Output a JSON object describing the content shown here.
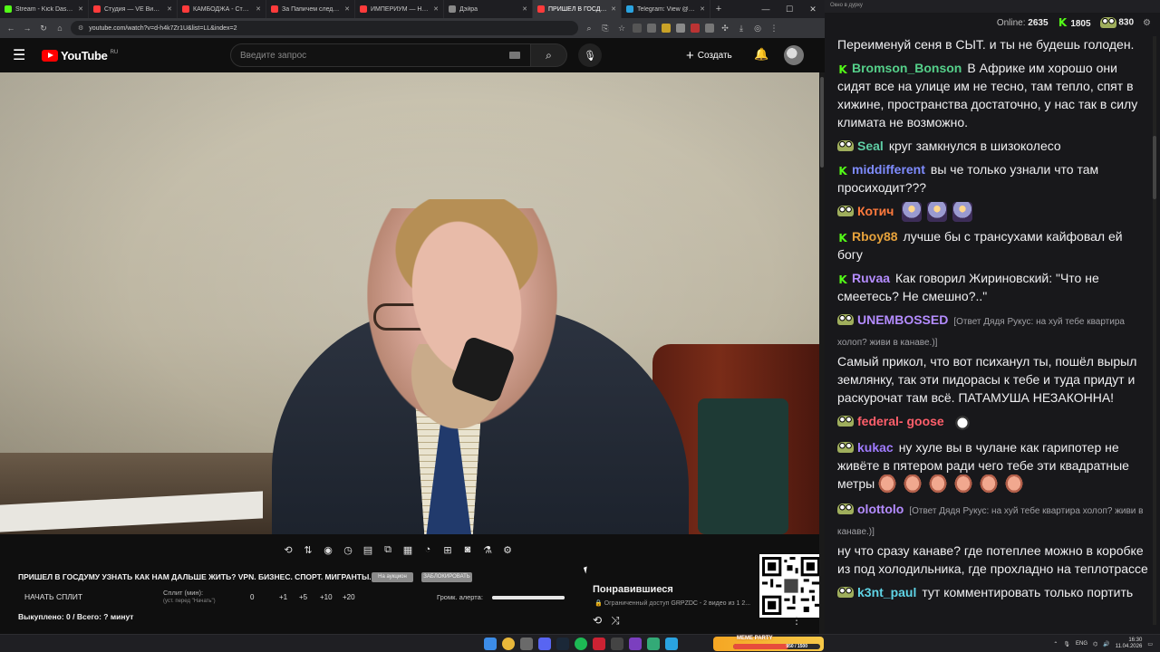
{
  "browser": {
    "tabs": [
      {
        "title": "Stream - Kick Dashboard",
        "color": "#53fc18"
      },
      {
        "title": "Студия — VE Видео Li...",
        "color": "#ff3b3b"
      },
      {
        "title": "КАМБОДЖА - Столиц...",
        "color": "#ff3b3b"
      },
      {
        "title": "За Папичем следят в ...",
        "color": "#ff3b3b"
      },
      {
        "title": "ИМПЕРИУМ — НЕ РО...",
        "color": "#ff3b3b"
      },
      {
        "title": "Дэйра",
        "color": "#888888"
      },
      {
        "title": "ПРИШЁЛ В ГОСДУМУ ...",
        "color": "#ff3b3b",
        "active": true
      },
      {
        "title": "Telegram: View @dvc...",
        "color": "#2aa3e0"
      }
    ],
    "url": "youtube.com/watch?v=d-h4k7Zr1U&list=LL&index=2"
  },
  "youtube": {
    "logo_text": "YouTube",
    "region": "RU",
    "search_placeholder": "Введите запрос",
    "create_label": "Создать"
  },
  "video_panel": {
    "title": "ПРИШЕЛ В ГОСДУМУ УЗНАТЬ КАК НАМ ДАЛЬШЕ ЖИТЬ? VPN. БИЗНЕС. СПОРТ. МИГРАНТЫ.",
    "badge1": "На аукцион",
    "badge2": "ЗАБЛОКИРОВАТЬ",
    "split_button": "НАЧАТЬ СПЛИТ",
    "split_label": "Сплит (мин):",
    "split_hint": "(уст. перед \"Начать\")",
    "split_values": [
      "0",
      "+1",
      "+5",
      "+10",
      "+20"
    ],
    "volume_label": "Громк. алерта:",
    "volume_level": 1.0,
    "bought": "Выкуплено: 0 / Всего: ? минут"
  },
  "playlist": {
    "title": "Понравившиеся",
    "restricted": "Ограниченный доступ",
    "meta": "GRPZDC - 2 видео из 1 2..."
  },
  "chat": {
    "window_title": "Окно в дурку",
    "online_label": "Online:",
    "online_count": "2635",
    "kick_count": "1805",
    "frog_count": "830",
    "messages": [
      {
        "platform": "",
        "user": "",
        "user_color": "#efeff1",
        "reply": "",
        "text": "Переименуй сеня в СЫТ. и ты не будешь голоден.",
        "emotes": []
      },
      {
        "platform": "kick",
        "user": "Bromson_Bonson",
        "user_color": "#55d08a",
        "reply": "",
        "text": "В Африке им хорошо они сидят все на улице им не тесно, там тепло, спят в хижине, пространства достаточно, у нас так в силу климата не возможно.",
        "emotes": []
      },
      {
        "platform": "frog",
        "user": "Seal",
        "user_color": "#5fcda5",
        "reply": "",
        "text": "круг замкнулся в шизоколесо",
        "emotes": []
      },
      {
        "platform": "kick",
        "user": "middifferent",
        "user_color": "#7f8cff",
        "reply": "",
        "text": "вы че только узнали что там просиходит???",
        "emotes": []
      },
      {
        "platform": "frog",
        "user": "Котич",
        "user_color": "#ff7a3d",
        "reply": "",
        "text": "",
        "emotes": [
          "rocket",
          "rocket",
          "rocket"
        ]
      },
      {
        "platform": "kick",
        "user": "Rboy88",
        "user_color": "#e6a23c",
        "reply": "",
        "text": "лучше бы с трансухами кайфовал ей богу",
        "emotes": []
      },
      {
        "platform": "kick",
        "user": "Ruvaa",
        "user_color": "#b48cff",
        "reply": "",
        "text": "Как говорил Жириновский: \"Что не смеетесь? Не смешно?..\"",
        "emotes": []
      },
      {
        "platform": "frog",
        "user": "UNEMBOSSED",
        "user_color": "#b48cff",
        "reply": "[Ответ Дядя Рукус: на хуй тебе квартира холоп? живи в канаве.)]",
        "text": "Самый прикол, что вот психанул ты, пошёл вырыл землянку, так эти пидорасы к тебе и туда придут и раскурочат там всё. ПАТАМУША НЕЗАКОННА!",
        "emotes": []
      },
      {
        "platform": "frog",
        "user": "federal- goose",
        "user_color": "#ff5f6b",
        "reply": "",
        "text": "",
        "emotes": [
          "blob"
        ]
      },
      {
        "platform": "frog",
        "user": "kukac",
        "user_color": "#a07bff",
        "reply": "",
        "text": "ну хуле вы в чулане как гарипотер не живёте в пятером ради чего тебе эти квадратные метры",
        "emotes": [
          "face",
          "face",
          "face",
          "face",
          "face",
          "face"
        ]
      },
      {
        "platform": "frog",
        "user": "olottolo",
        "user_color": "#b48cff",
        "reply": "[Ответ Дядя Рукус: на хуй тебе квартира холоп? живи в канаве.)]",
        "text": "ну что сразу канаве? где потеплее можно в коробке из под холодильника, где прохладно на теплотрассе",
        "emotes": []
      },
      {
        "platform": "frog",
        "user": "k3nt_paul",
        "user_color": "#5fd4e6",
        "reply": "",
        "text": "тут комментировать только портить",
        "emotes": []
      }
    ]
  },
  "taskbar": {
    "meme_title": "MEME PARTY",
    "meme_progress": "950 / 1500",
    "lang": "ENG",
    "time": "16:30",
    "date": "11.04.2026"
  }
}
